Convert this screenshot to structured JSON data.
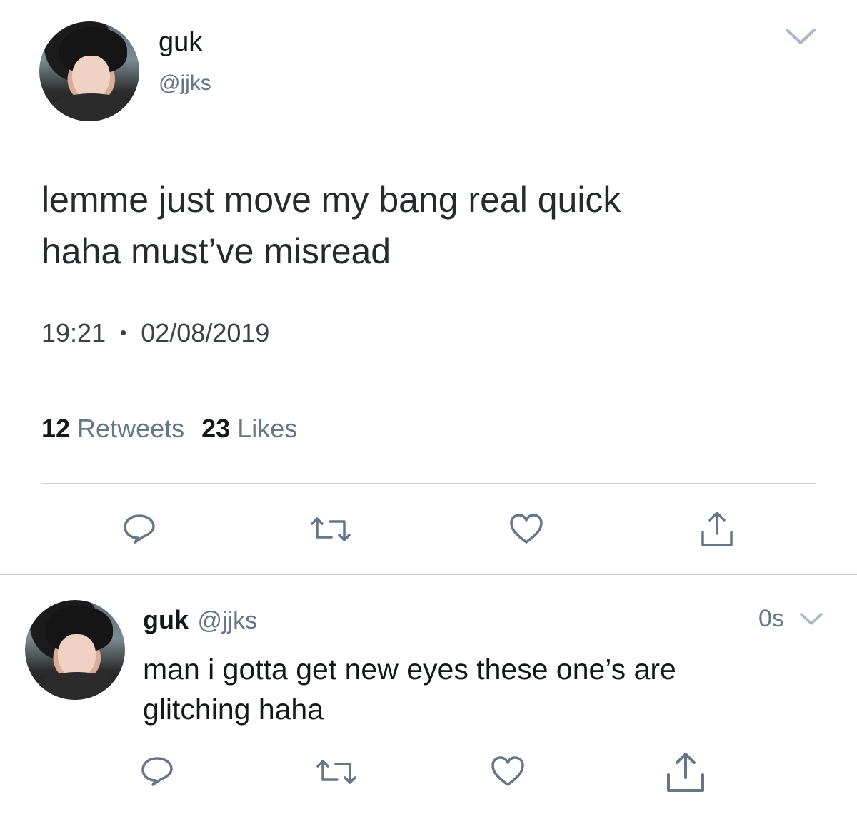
{
  "tweet": {
    "name": "guk",
    "handle": "@jjks",
    "text_line1": "lemme just move my bang real quick",
    "text_line2": "haha must’ve misread",
    "time": "19:21",
    "separator": "•",
    "date": "02/08/2019",
    "retweets_count": "12",
    "retweets_label": "Retweets",
    "likes_count": "23",
    "likes_label": "Likes",
    "menu_icon": "chevron-down-icon",
    "actions": [
      "reply-icon",
      "retweet-icon",
      "like-icon",
      "share-icon"
    ]
  },
  "reply": {
    "name": "guk",
    "handle": "@jjks",
    "time": "0s",
    "text_line1": "man i gotta get new eyes these one’s are",
    "text_line2": "glitching haha",
    "actions": [
      "reply-icon",
      "retweet-icon",
      "like-icon",
      "share-icon"
    ]
  },
  "colors": {
    "icon": "#657786",
    "divider": "#d0d4d8",
    "text": "#14171a"
  }
}
